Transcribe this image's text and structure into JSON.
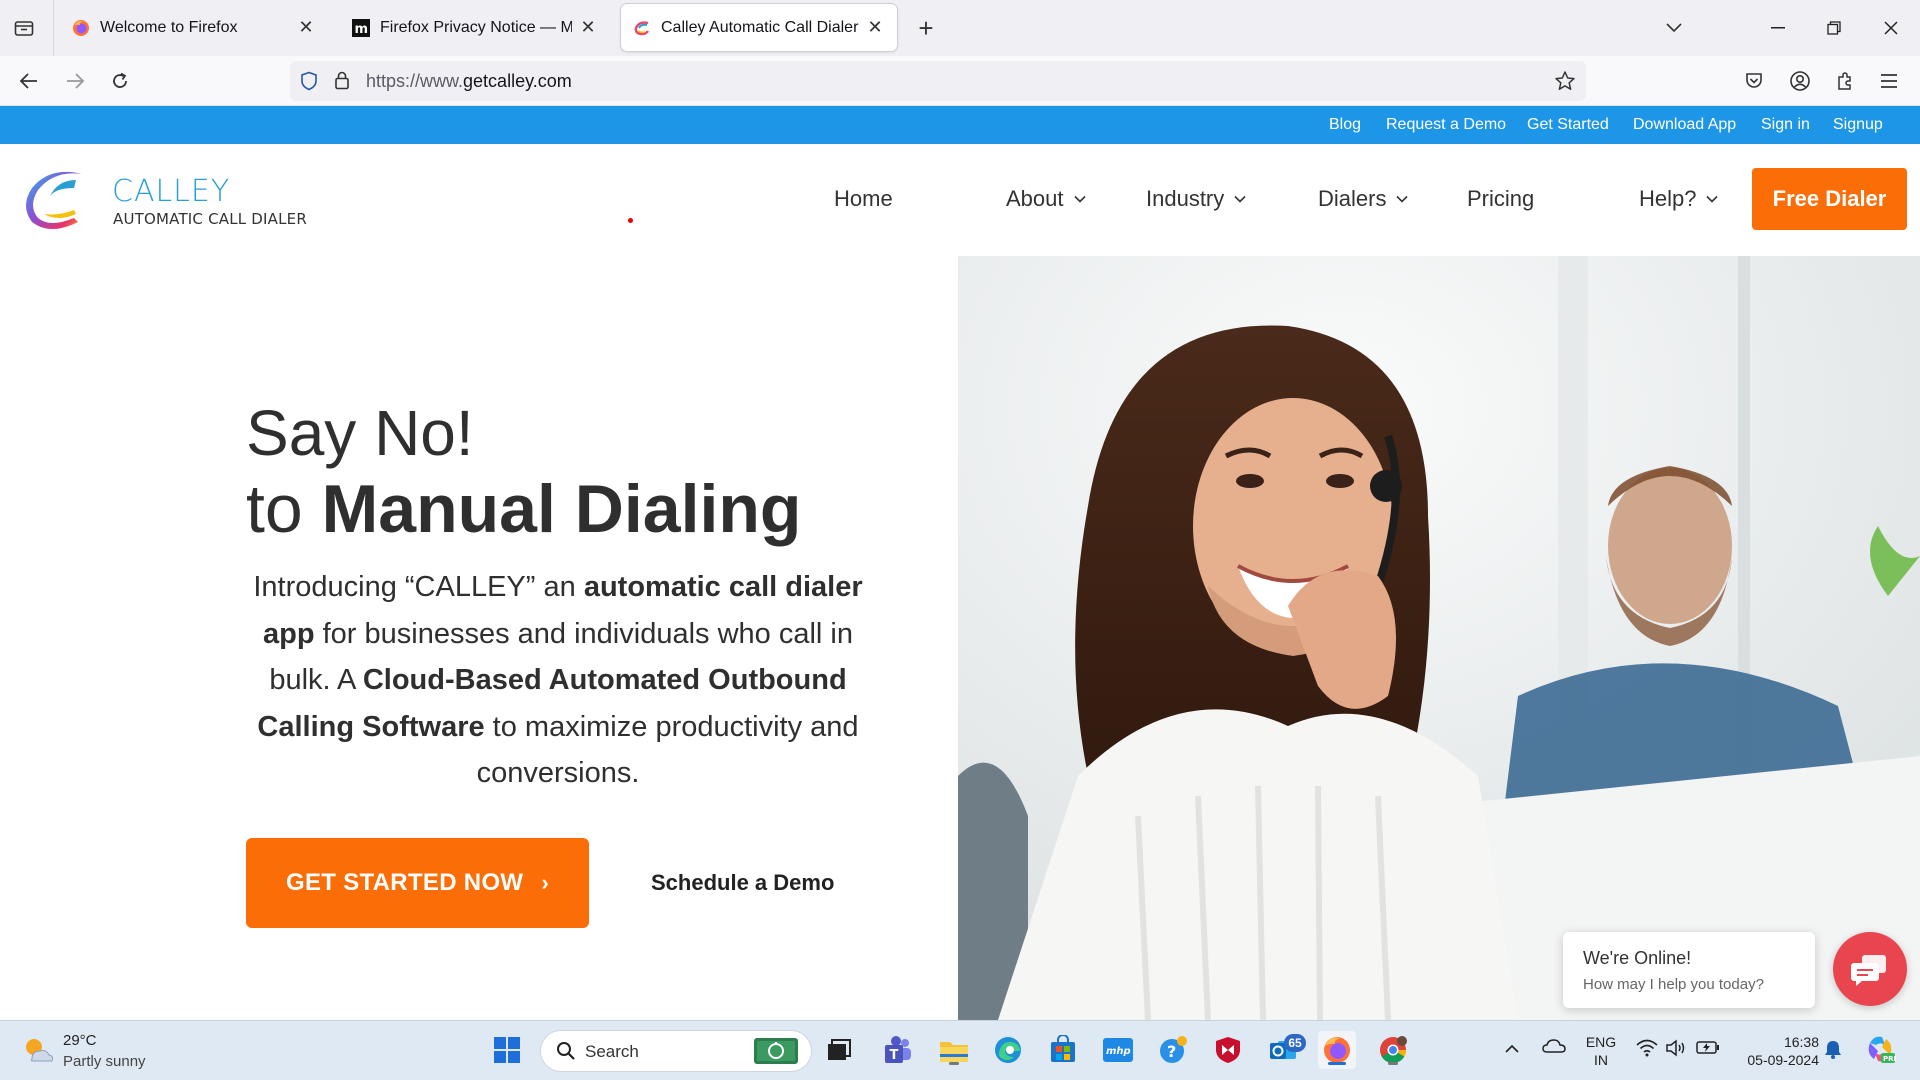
{
  "browser": {
    "tabs": [
      {
        "title": "Welcome to Firefox"
      },
      {
        "title": "Firefox Privacy Notice — Mozill"
      },
      {
        "title": "Calley Automatic Call Dialer For"
      }
    ],
    "url_prefix": "https://www.",
    "url_domain": "getcalley.com"
  },
  "site": {
    "topbar_links": [
      "Blog",
      "Request a Demo",
      "Get Started",
      "Download App",
      "Sign in",
      "Signup"
    ],
    "logo": {
      "name": "CALLEY",
      "tagline": "AUTOMATIC CALL DIALER"
    },
    "menu": [
      "Home",
      "About",
      "Industry",
      "Dialers",
      "Pricing",
      "Help?"
    ],
    "cta_header": "Free Dialer",
    "hero": {
      "line1": "Say No!",
      "line2_prefix": "to",
      "line2_bold": "Manual Dialing",
      "intro_1": "Introducing “CALLEY” an ",
      "intro_2": "automatic call dialer app",
      "intro_3": " for businesses and individuals who call in bulk. A ",
      "intro_4": "Cloud-Based Automated Outbound Calling Software",
      "intro_5": " to maximize productivity and conversions.",
      "primary_cta": "GET STARTED NOW",
      "secondary_cta": "Schedule a Demo"
    },
    "chat": {
      "title": "We're Online!",
      "subtitle": "How may I help you today?"
    },
    "colors": {
      "topbar": "#1e96e8",
      "cta": "#fb6d07",
      "logo": "#2a9fd6",
      "chat": "#e8454e"
    }
  },
  "taskbar": {
    "weather_temp": "29°C",
    "weather_desc": "Partly sunny",
    "search_placeholder": "Search",
    "notification_badge": "65",
    "lang_1": "ENG",
    "lang_2": "IN",
    "time": "16:38",
    "date": "05-09-2024"
  }
}
